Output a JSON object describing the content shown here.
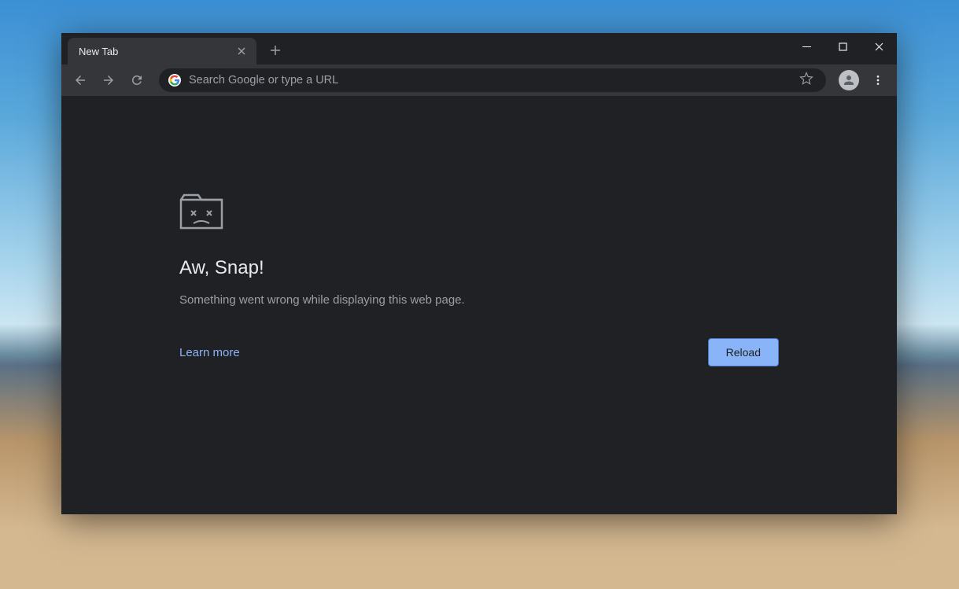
{
  "tab": {
    "title": "New Tab"
  },
  "omnibox": {
    "placeholder": "Search Google or type a URL",
    "value": ""
  },
  "error": {
    "title": "Aw, Snap!",
    "message": "Something went wrong while displaying this web page.",
    "learn_more": "Learn more",
    "reload": "Reload"
  },
  "colors": {
    "accent": "#8ab4f8",
    "bg": "#202124",
    "toolbar": "#35363a"
  }
}
